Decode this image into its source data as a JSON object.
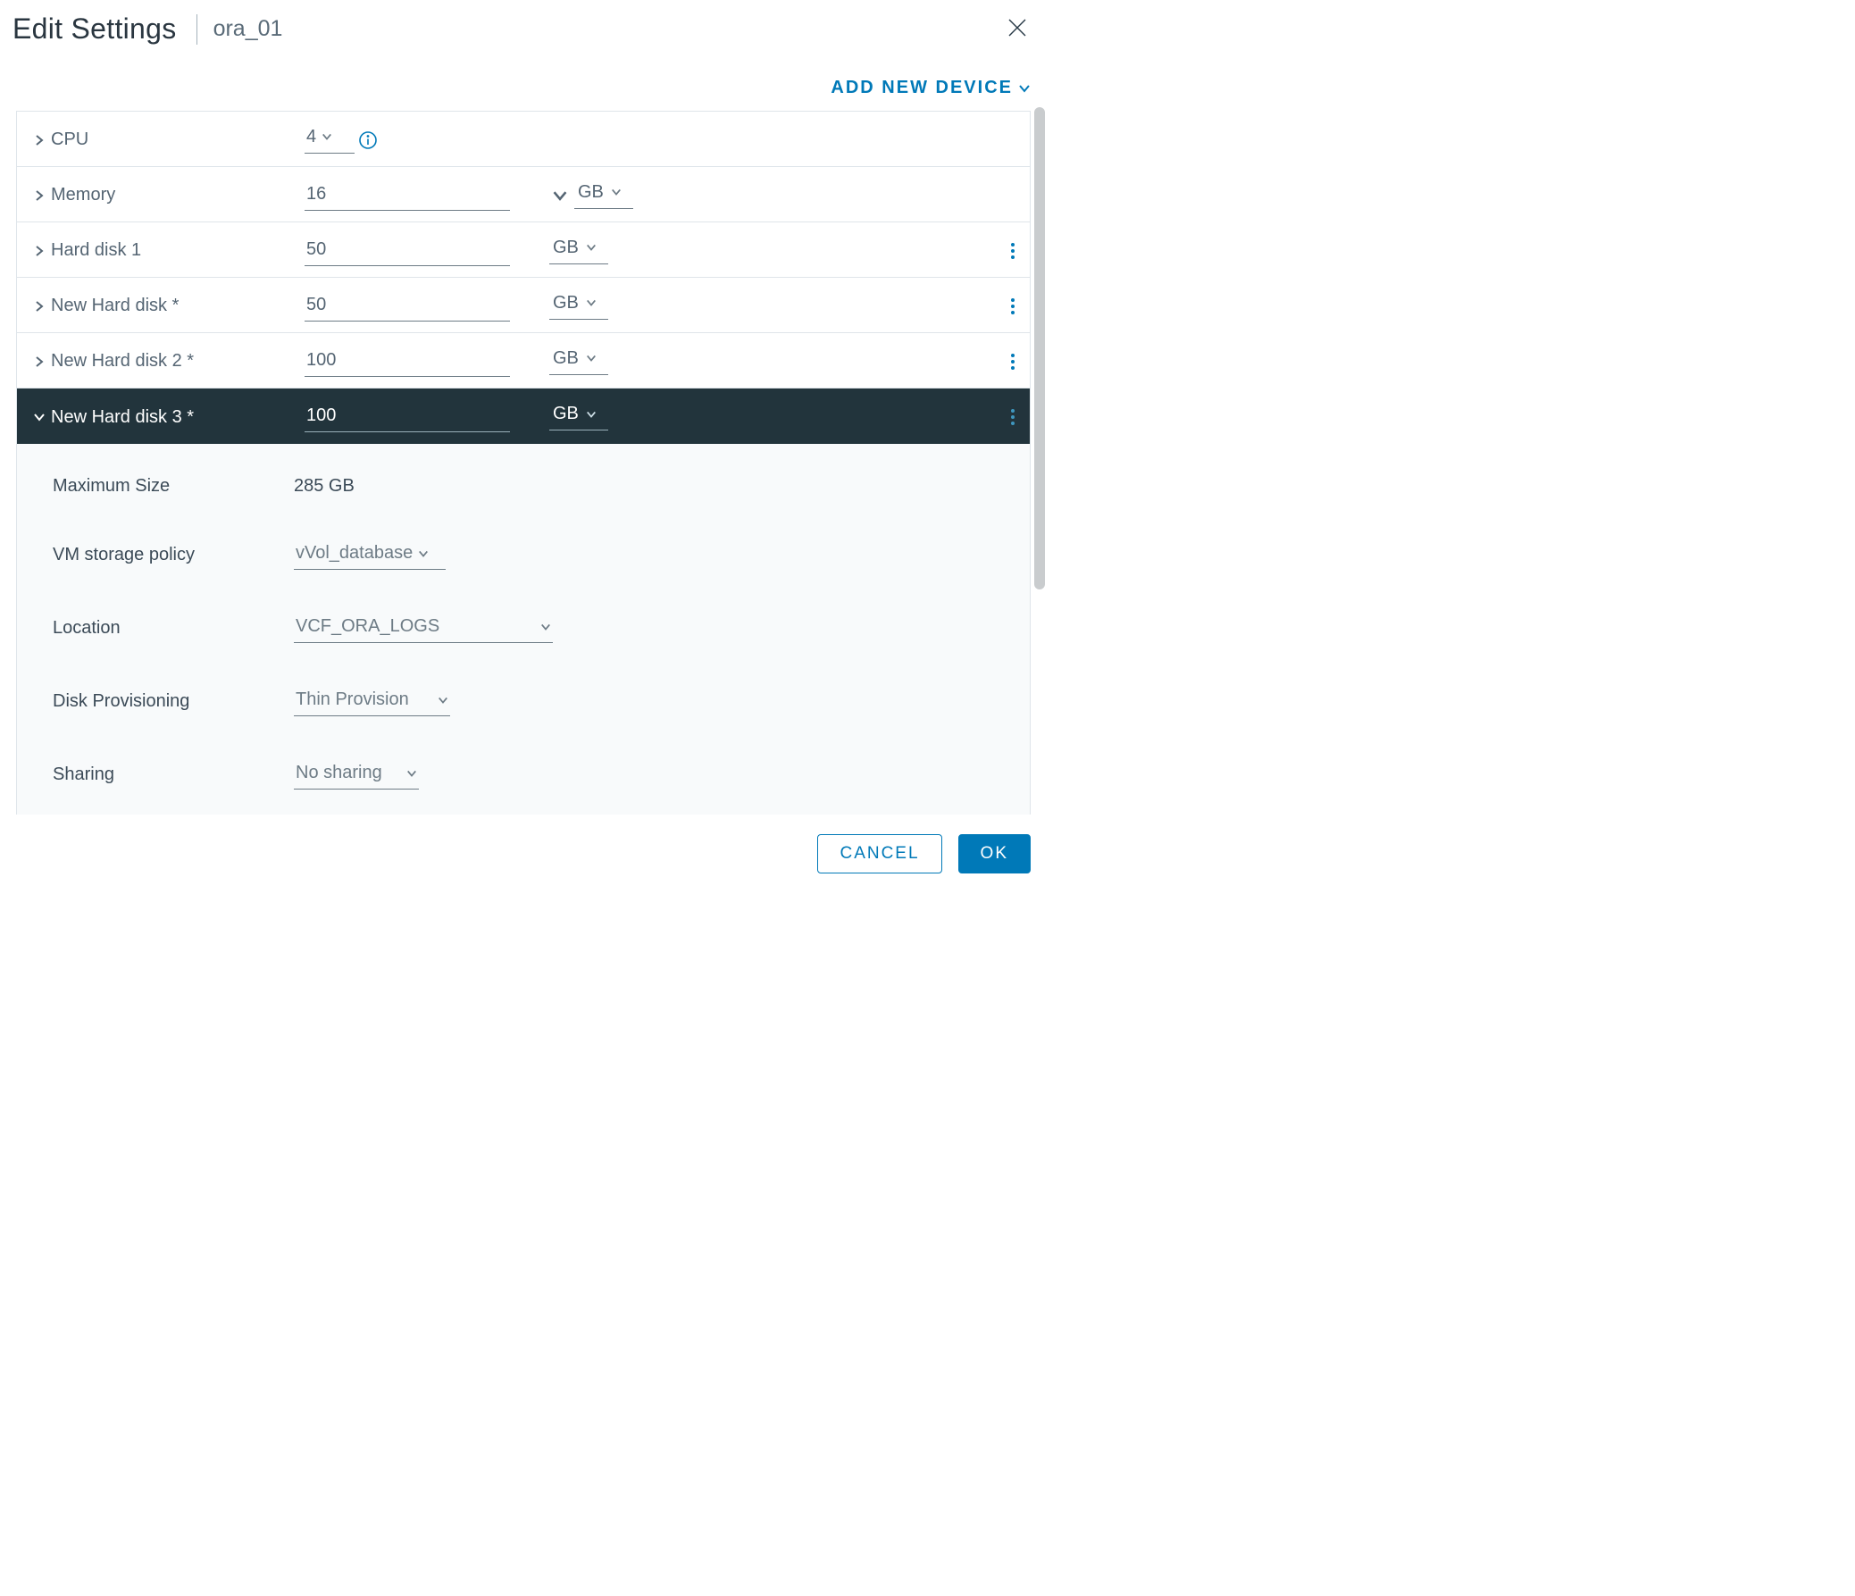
{
  "header": {
    "title": "Edit Settings",
    "subtitle": "ora_01"
  },
  "toolbar": {
    "add_device": "ADD NEW DEVICE"
  },
  "rows": {
    "cpu": {
      "label": "CPU",
      "value": "4"
    },
    "mem": {
      "label": "Memory",
      "value": "16",
      "unit": "GB"
    },
    "hd1": {
      "label": "Hard disk 1",
      "value": "50",
      "unit": "GB"
    },
    "nhd1": {
      "label": "New Hard disk *",
      "value": "50",
      "unit": "GB"
    },
    "nhd2": {
      "label": "New Hard disk 2 *",
      "value": "100",
      "unit": "GB"
    },
    "nhd3": {
      "label": "New Hard disk 3 *",
      "value": "100",
      "unit": "GB"
    }
  },
  "detail": {
    "max_size": {
      "label": "Maximum Size",
      "value": "285 GB"
    },
    "policy": {
      "label": "VM storage policy",
      "value": "vVol_database"
    },
    "location": {
      "label": "Location",
      "value": "VCF_ORA_LOGS"
    },
    "provision": {
      "label": "Disk Provisioning",
      "value": "Thin Provision"
    },
    "sharing": {
      "label": "Sharing",
      "value": "No sharing"
    }
  },
  "footer": {
    "cancel": "CANCEL",
    "ok": "OK"
  }
}
